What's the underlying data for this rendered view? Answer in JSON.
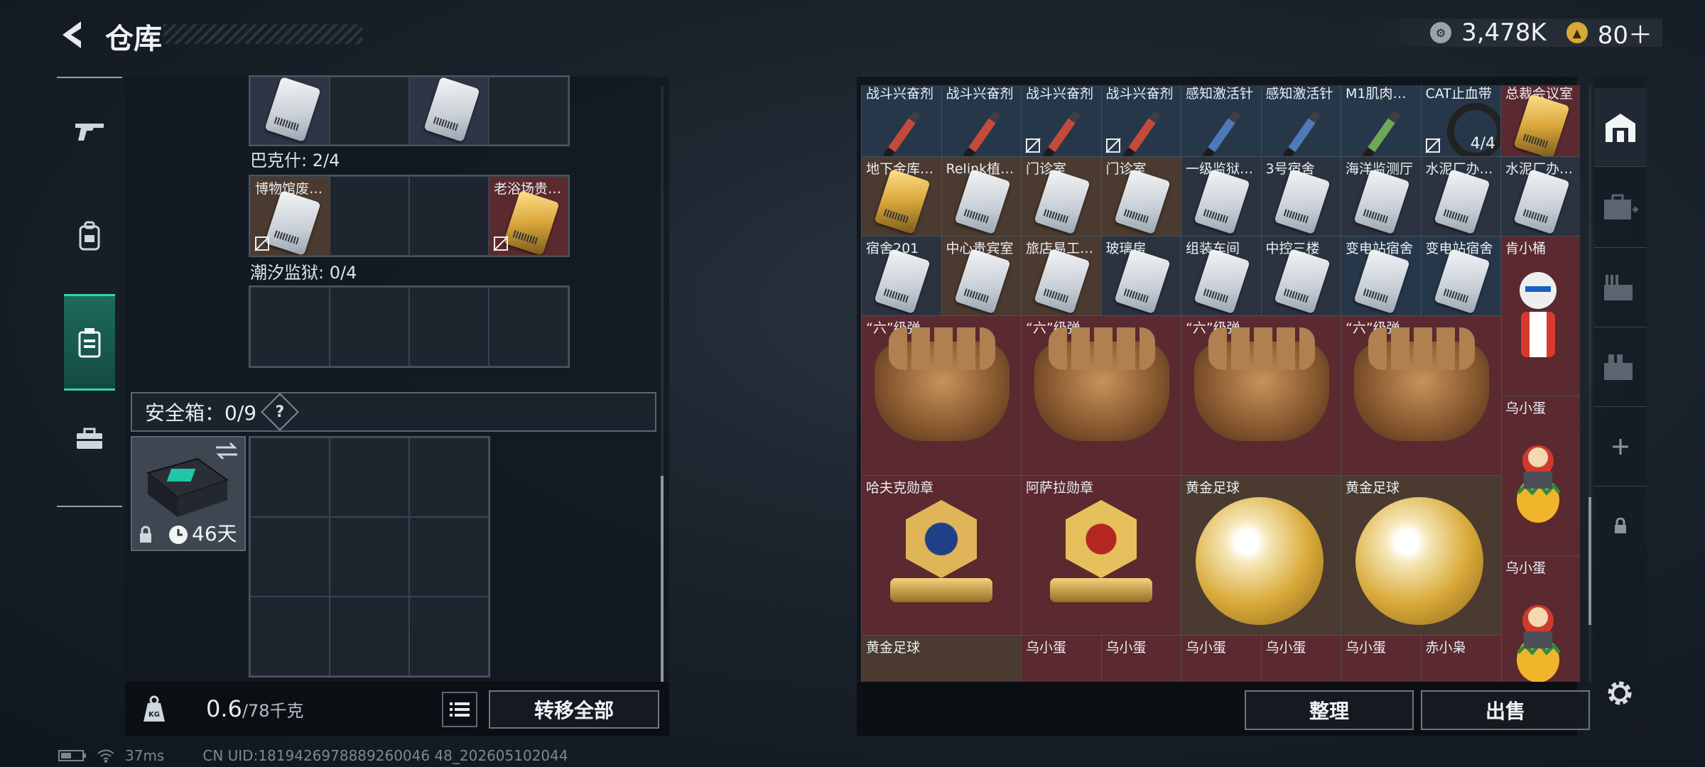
{
  "header": {
    "title": "仓库",
    "currency_coins": "3,478K",
    "currency_tokens": "80＋",
    "colors": {
      "accent": "#33d6ae",
      "coin": "#9aa3ad",
      "token": "#d4a83a"
    }
  },
  "nav": {
    "items": [
      {
        "icon": "gun-icon"
      },
      {
        "icon": "backpack-icon"
      },
      {
        "icon": "vest-icon",
        "active": true
      },
      {
        "icon": "toolbox-icon"
      }
    ]
  },
  "backpack": {
    "sections": [
      {
        "label": "",
        "slots": [
          {
            "type": "card"
          },
          {
            "type": "empty"
          },
          {
            "type": "card"
          },
          {
            "type": "empty"
          }
        ]
      },
      {
        "label": "巴克什: 2/4",
        "slots": [
          {
            "type": "card",
            "name": "博物馆废…",
            "bg": "brown",
            "noxfer": true
          },
          {
            "type": "empty"
          },
          {
            "type": "empty"
          },
          {
            "type": "card",
            "name": "老浴场贵…",
            "bg": "red",
            "noxfer": true
          }
        ]
      },
      {
        "label": "潮汐监狱: 0/4",
        "slots": [
          {
            "type": "empty"
          },
          {
            "type": "empty"
          },
          {
            "type": "empty"
          },
          {
            "type": "empty"
          }
        ]
      }
    ],
    "safe": {
      "label": "安全箱：0/9",
      "help": "?",
      "days": "46天"
    },
    "weight": {
      "current": "0.6",
      "max": "/78千克",
      "icon_text": "KG"
    },
    "transfer_all": "转移全部"
  },
  "warehouse": {
    "row1": [
      {
        "name": "战斗兴奋剂",
        "item": "syringe-red",
        "bg": "blue"
      },
      {
        "name": "战斗兴奋剂",
        "item": "syringe-red",
        "bg": "blue"
      },
      {
        "name": "战斗兴奋剂",
        "item": "syringe-red",
        "bg": "blue",
        "noxfer": true
      },
      {
        "name": "战斗兴奋剂",
        "item": "syringe-red",
        "bg": "blue",
        "noxfer": true
      },
      {
        "name": "感知激活针",
        "item": "syringe-blue",
        "bg": "blue"
      },
      {
        "name": "感知激活针",
        "item": "syringe-blue",
        "bg": "blue"
      },
      {
        "name": "M1肌肉…",
        "item": "syringe-green",
        "bg": "blue"
      },
      {
        "name": "CAT止血带",
        "item": "band",
        "bg": "blue",
        "count": "4/4",
        "noxfer": true
      },
      {
        "name": "总裁会议室",
        "item": "card-gold",
        "bg": "red"
      }
    ],
    "row2": [
      {
        "name": "地下金库…",
        "item": "card-gold",
        "bg": "brown"
      },
      {
        "name": "Relink植…",
        "item": "card",
        "bg": "brown"
      },
      {
        "name": "门诊室",
        "item": "card",
        "bg": "brown"
      },
      {
        "name": "门诊室",
        "item": "card",
        "bg": "brown"
      },
      {
        "name": "一级监狱…",
        "item": "card",
        "bg": "dark"
      },
      {
        "name": "3号宿舍",
        "item": "card",
        "bg": "dark"
      },
      {
        "name": "海洋监测厅",
        "item": "card",
        "bg": "dark"
      },
      {
        "name": "水泥厂办…",
        "item": "card",
        "bg": "dark"
      },
      {
        "name": "水泥厂办…",
        "item": "card",
        "bg": "dark"
      }
    ],
    "row3": [
      {
        "name": "宿舍201",
        "item": "card",
        "bg": "dark"
      },
      {
        "name": "中心贵宾室",
        "item": "card",
        "bg": "brown"
      },
      {
        "name": "旅店易工…",
        "item": "card",
        "bg": "brown"
      },
      {
        "name": "玻璃房",
        "item": "card",
        "bg": "dark"
      },
      {
        "name": "组装车间",
        "item": "card",
        "bg": "dark"
      },
      {
        "name": "中控三楼",
        "item": "card",
        "bg": "dark"
      },
      {
        "name": "变电站宿舍",
        "item": "card",
        "bg": "blue"
      },
      {
        "name": "变电站宿舍",
        "item": "card",
        "bg": "blue"
      }
    ],
    "tall_col": [
      {
        "name": "肯小桶",
        "item": "figure-kfc"
      },
      {
        "name": "乌小蛋",
        "item": "figure-egg"
      },
      {
        "name": "乌小蛋",
        "item": "figure-egg"
      }
    ],
    "gloves": [
      {
        "name": "“六”级弹"
      },
      {
        "name": "“六”级弹"
      },
      {
        "name": "“六”级弹"
      },
      {
        "name": "“六”级弹"
      }
    ],
    "big_row": [
      {
        "name": "哈夫克勋章",
        "item": "medal-blue",
        "bg": "red"
      },
      {
        "name": "阿萨拉勋章",
        "item": "medal-red",
        "bg": "red"
      },
      {
        "name": "黄金足球",
        "item": "ball",
        "bg": "brown"
      },
      {
        "name": "黄金足球",
        "item": "ball",
        "bg": "brown"
      }
    ],
    "bottom_row": [
      "黄金足球",
      "乌小蛋",
      "乌小蛋",
      "乌小蛋",
      "乌小蛋",
      "乌小蛋",
      "赤小枭"
    ],
    "sort_btn": "整理",
    "sell_btn": "出售"
  },
  "status": {
    "ping": "37ms",
    "uid": "CN UID:1819426978889260046 48_202605102044"
  }
}
